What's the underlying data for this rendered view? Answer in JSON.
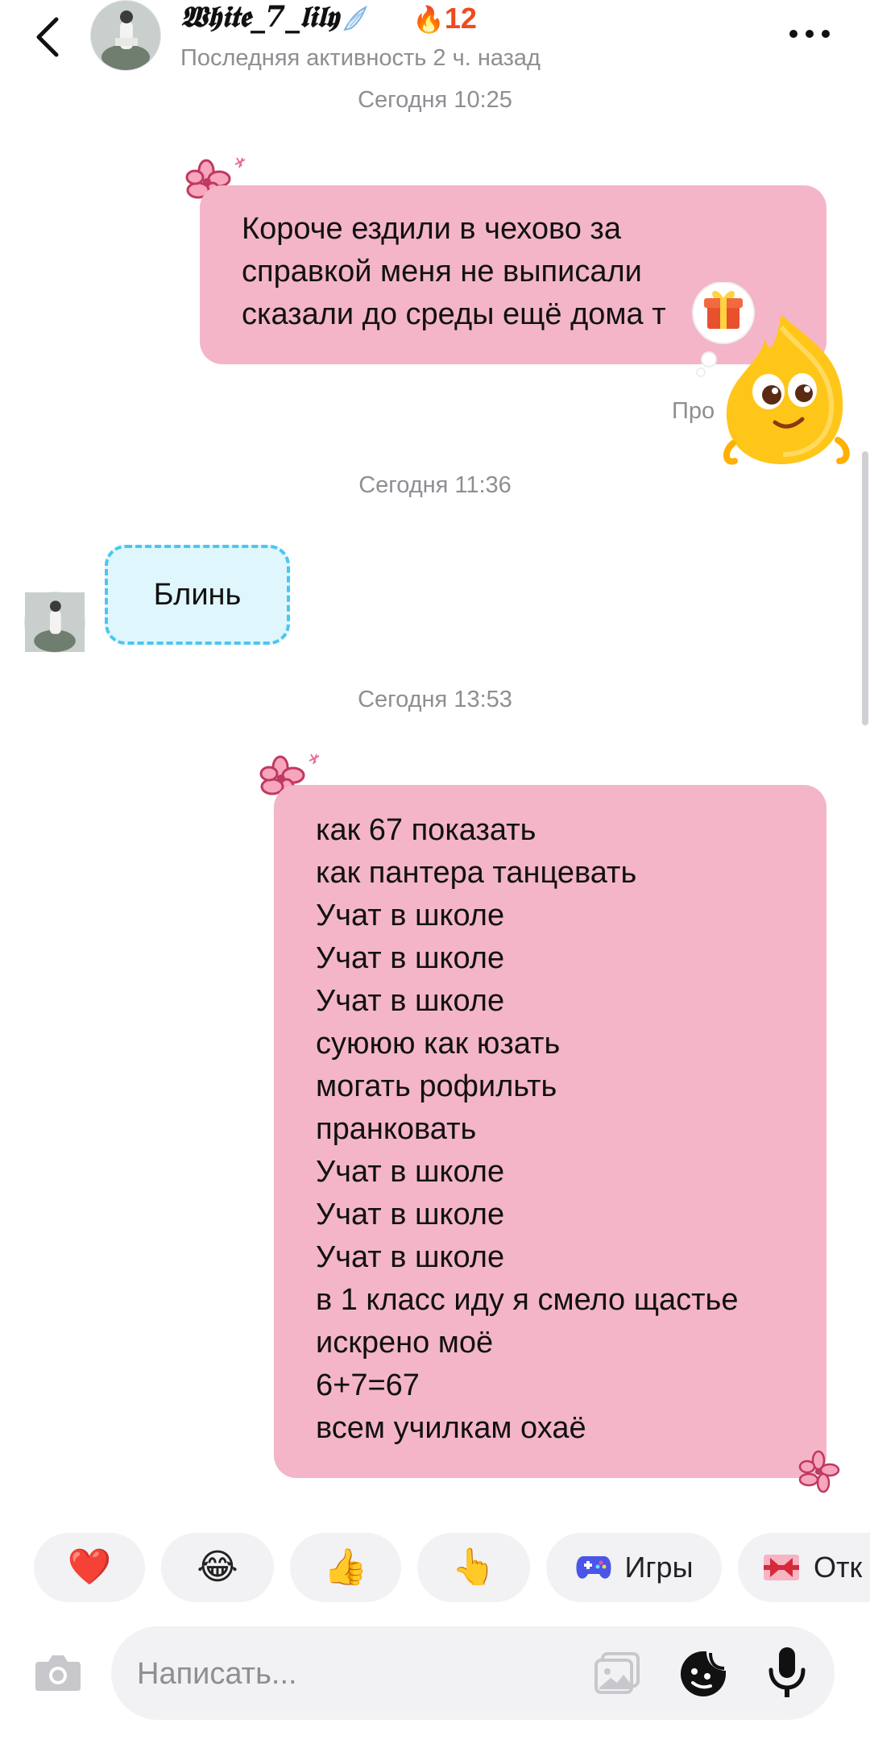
{
  "header": {
    "back_icon": "chevron-left-icon",
    "username": "𝖂𝖍𝖎𝖙𝖊_7_𝖑𝖎𝖑𝖞",
    "streak_icon": "fire-icon",
    "streak_count": "12",
    "status": "Последняя активность 2 ч. назад",
    "more_icon": "more-horizontal-icon"
  },
  "messages": {
    "ts1": "Сегодня 10:25",
    "msg1_lines": [
      "Короче ездили в чехово за",
      "справкой меня не выписали",
      "сказали до среды ещё дома т"
    ],
    "read_status": "Про",
    "ts2": "Сегодня 11:36",
    "msg2": "Блинь",
    "ts3": "Сегодня 13:53",
    "msg3_lines": [
      "как 67 показать",
      "как пантера танцевать",
      "Учат в школе",
      "Учат в школе",
      "Учат в школе",
      "суююю как юзать",
      "могать рофильть",
      "пранковать",
      "Учат в школе",
      "Учат в школе",
      "Учат в школе",
      "в 1 класс иду я смело щастье",
      "искрено моё",
      "6+7=67",
      "всем училкам охаё"
    ]
  },
  "quick_replies": {
    "heart": "❤️",
    "laugh": "😂",
    "thumbs_up": "👍",
    "point": "👆",
    "games_label": "Игры",
    "games_icon": "gamepad-icon",
    "gift_label": "Отк",
    "gift_icon": "gift-box-icon"
  },
  "composer": {
    "placeholder": "Написать...",
    "camera_icon": "camera-icon",
    "gallery_icon": "gallery-icon",
    "sticker_icon": "sticker-icon",
    "mic_icon": "microphone-icon"
  },
  "colors": {
    "outgoing_bubble": "#f4b5c8",
    "incoming_bubble": "#dff6fd",
    "incoming_border": "#4cc6ef",
    "accent_streak": "#f04a1e",
    "flower": "#c0395f"
  }
}
